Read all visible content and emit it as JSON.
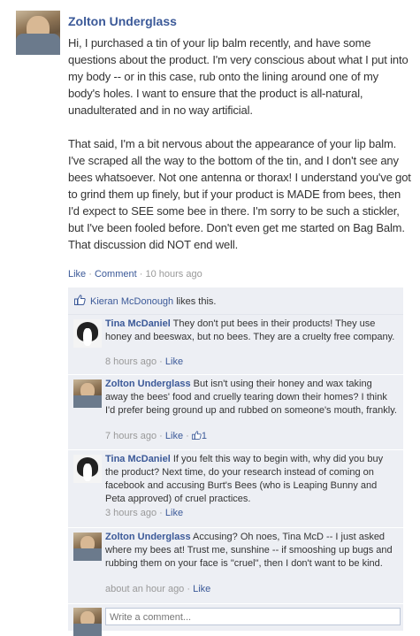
{
  "post": {
    "author": "Zolton Underglass",
    "body": "Hi, I purchased a tin of your lip balm recently, and have some questions about the product. I'm very conscious about what I put into my body -- or in this case, rub onto the lining around one of my body's holes. I want to ensure that the product is all-natural, unadulterated and in no way artificial.\n\nThat said, I'm a bit nervous about the appearance of your lip balm. I've scraped all the way to the bottom of the tin, and I don't see any bees whatsoever. Not one antenna or thorax! I understand you've got to grind them up finely, but if your product is MADE from bees, then I'd expect to SEE some bee in there. I'm sorry to be such a stickler, but I've been fooled before. Don't even get me started on Bag Balm. That discussion did NOT end well.",
    "like_label": "Like",
    "comment_label": "Comment",
    "timestamp": "10 hours ago",
    "separator": "·"
  },
  "likes": {
    "icon": "thumbs-up-icon",
    "name": "Kieran McDonough",
    "text": " likes this."
  },
  "comments": [
    {
      "author": "Tina McDaniel",
      "text": "They don't put bees in their products! They use honey and beeswax, but no bees. They are a cruelty free company.",
      "timestamp": "8 hours ago",
      "like_label": "Like",
      "like_count": ""
    },
    {
      "author": "Zolton Underglass",
      "text": "But isn't using their honey and wax taking away the bees' food and cruelly tearing down their homes? I think I'd prefer being ground up and rubbed on someone's mouth, frankly.",
      "timestamp": "7 hours ago",
      "like_label": "Like",
      "like_count": "1"
    },
    {
      "author": "Tina McDaniel",
      "text": "If you felt this way to begin with, why did you buy the product? Next time, do your research instead of coming on facebook and accusing Burt's Bees (who is Leaping Bunny and Peta approved) of cruel practices.",
      "timestamp": "3 hours ago",
      "like_label": "Like",
      "like_count": ""
    },
    {
      "author": "Zolton Underglass",
      "text": "Accusing? Oh noes, Tina McD -- I just asked where my bees at! Trust me, sunshine -- if smooshing up bugs and rubbing them on your face is \"cruel\", then I don't want to be kind.",
      "timestamp": "about an hour ago",
      "like_label": "Like",
      "like_count": ""
    }
  ],
  "write_comment": {
    "placeholder": "Write a comment..."
  }
}
